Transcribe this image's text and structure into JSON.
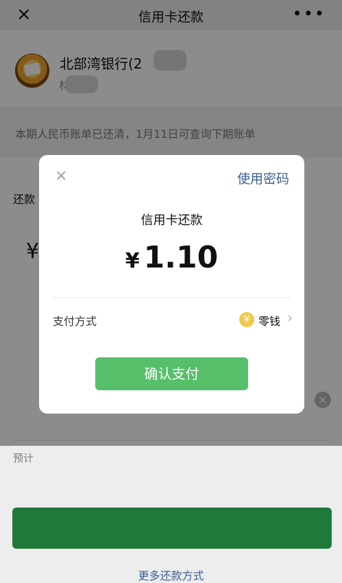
{
  "header": {
    "close_icon": "×",
    "title": "信用卡还款",
    "more_icon": "•••"
  },
  "bank": {
    "name": "北部湾银行(2",
    "sub": "材"
  },
  "notice": {
    "text": "本期人民币账单已还清，1月11日可查询下期账单"
  },
  "form": {
    "repay_label": "还款",
    "yen": "¥",
    "est_label": "预计",
    "more_methods": "更多还款方式",
    "clear_icon": "×"
  },
  "dialog": {
    "close_icon": "×",
    "use_password": "使用密码",
    "title": "信用卡还款",
    "amount_symbol": "¥",
    "amount": "1.10",
    "pay_method_label": "支付方式",
    "pay_method_icon": "¥",
    "pay_method_value": "零钱",
    "chevron": "›",
    "confirm": "确认支付"
  },
  "colors": {
    "accent_blue": "#3a5f94",
    "confirm_green": "#57be6a",
    "coin_yellow": "#f1c84a"
  }
}
